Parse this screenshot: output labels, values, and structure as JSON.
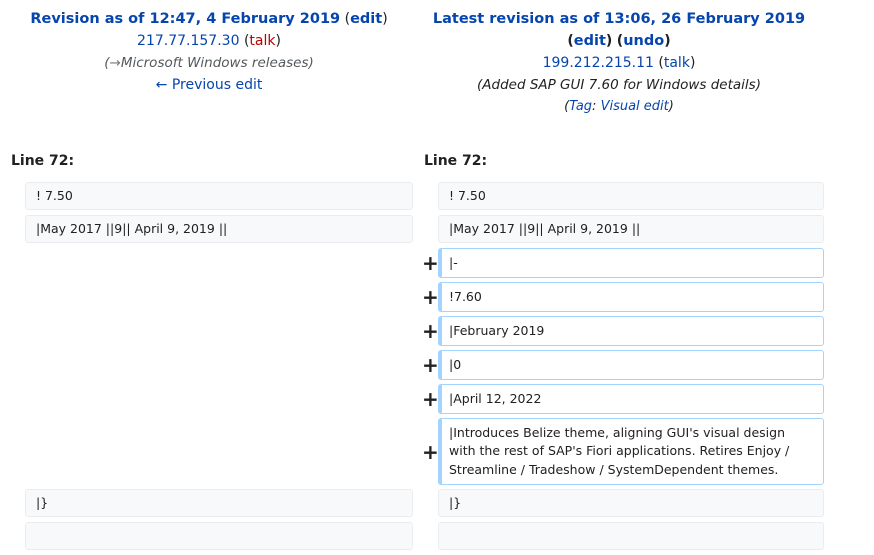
{
  "left_header": {
    "title": "Revision as of 12:47, 4 February 2019",
    "edit_label": "edit",
    "user_ip": "217.77.157.30",
    "talk_label": "talk",
    "summary_arrow": "→",
    "summary_text": "Microsoft Windows releases",
    "prev_edit": "← Previous edit"
  },
  "right_header": {
    "title": "Latest revision as of 13:06, 26 February 2019",
    "edit_label": "edit",
    "undo_label": "undo",
    "user_ip": "199.212.215.11",
    "talk_label": "talk",
    "summary_text": "(Added SAP GUI 7.60 for Windows details)",
    "tag_label": "Tag",
    "tag_value": "Visual edit"
  },
  "line_left": "Line 72:",
  "line_right": "Line 72:",
  "context_rows": [
    {
      "left": "! 7.50",
      "right": "! 7.50"
    },
    {
      "left": "|May 2017 ||9|| April 9, 2019 ||",
      "right": "|May 2017 ||9|| April 9, 2019 ||"
    }
  ],
  "added_rows": [
    "|-",
    "!7.60",
    "|February 2019",
    "|0",
    "|April 12, 2022",
    "|Introduces Belize theme, aligning GUI's visual design with the rest of SAP's Fiori applications. Retires Enjoy / Streamline / Tradeshow / SystemDependent themes."
  ],
  "trailing_rows": [
    {
      "left": "|}",
      "right": "|}"
    },
    {
      "left": "",
      "right": ""
    }
  ],
  "marker_symbol": "+"
}
